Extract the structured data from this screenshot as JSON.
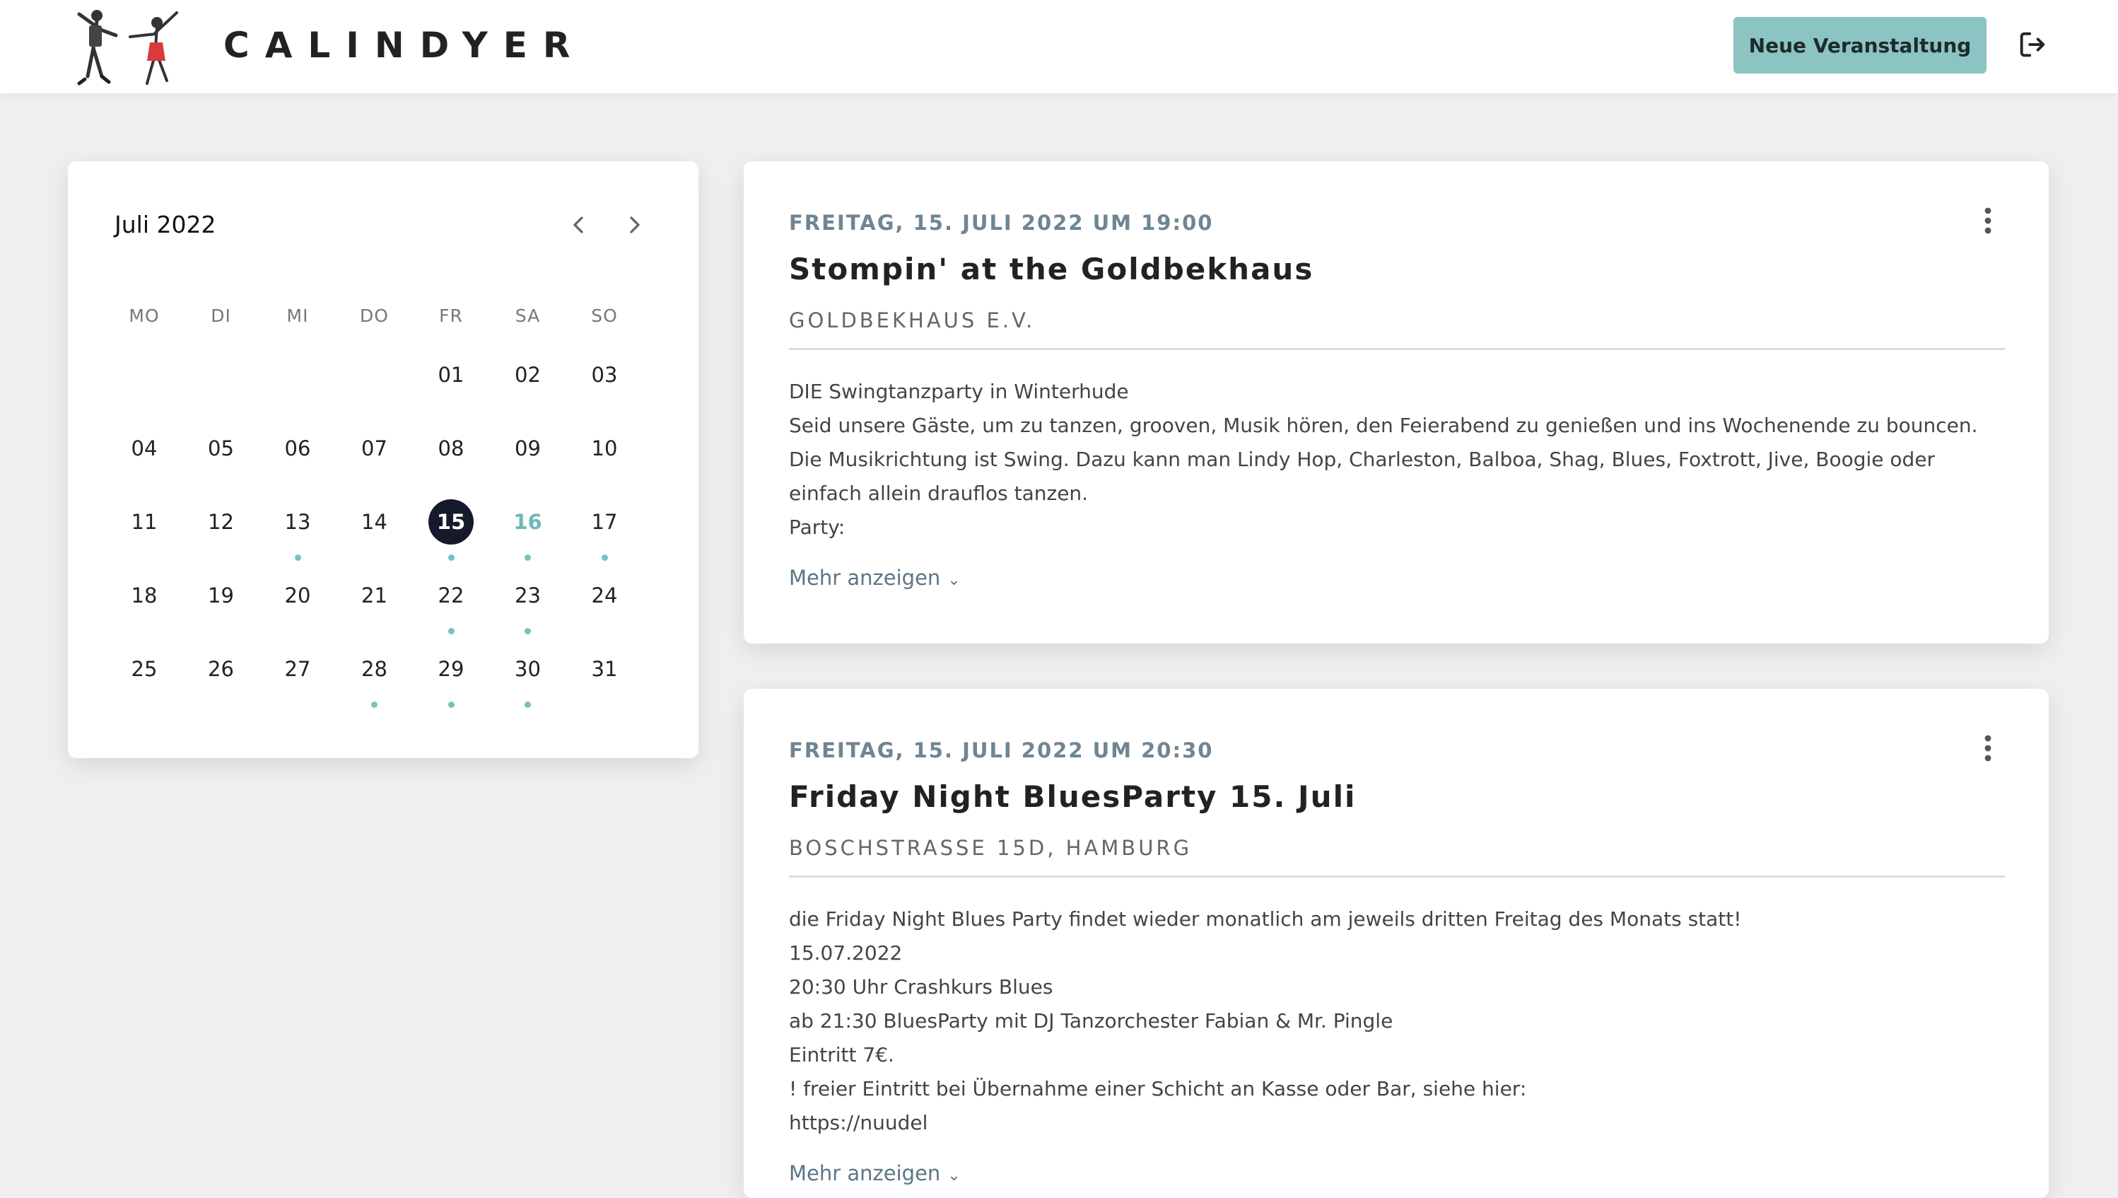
{
  "header": {
    "brand": "CALINDYER",
    "new_event_label": "Neue Veranstaltung"
  },
  "calendar": {
    "month_label": "Juli 2022",
    "weekdays": [
      "MO",
      "DI",
      "MI",
      "DO",
      "FR",
      "SA",
      "SO"
    ],
    "days": [
      [
        "",
        "",
        "",
        "",
        "01",
        "02",
        "03"
      ],
      [
        "04",
        "05",
        "06",
        "07",
        "08",
        "09",
        "10"
      ],
      [
        "11",
        "12",
        "13",
        "14",
        "15",
        "16",
        "17"
      ],
      [
        "18",
        "19",
        "20",
        "21",
        "22",
        "23",
        "24"
      ],
      [
        "25",
        "26",
        "27",
        "28",
        "29",
        "30",
        "31"
      ]
    ],
    "selected_day": "15",
    "highlighted_day": "16",
    "event_days": [
      "13",
      "15",
      "16",
      "17",
      "22",
      "23",
      "28",
      "29",
      "30"
    ]
  },
  "events": [
    {
      "date": "FREITAG, 15. JULI 2022 UM 19:00",
      "title": "Stompin' at the Goldbekhaus",
      "location": "GOLDBEKHAUS E.V.",
      "description": [
        "DIE Swingtanzparty in Winterhude",
        "Seid unsere Gäste, um zu tanzen, grooven, Musik hören, den Feierabend zu genießen und ins Wochenende zu bouncen.",
        "Die Musikrichtung ist Swing. Dazu kann man Lindy Hop, Charleston, Balboa, Shag, Blues, Foxtrott, Jive, Boogie oder",
        "einfach allein drauflos tanzen.",
        "Party:"
      ],
      "more_label": "Mehr anzeigen"
    },
    {
      "date": "FREITAG, 15. JULI 2022 UM 20:30",
      "title": "Friday Night BluesParty 15. Juli",
      "location": "BOSCHSTRASSE 15D, HAMBURG",
      "description": [
        "die Friday Night Blues Party findet wieder monatlich am jeweils dritten Freitag des Monats statt!",
        "15.07.2022",
        "20:30 Uhr Crashkurs Blues",
        "ab 21:30 BluesParty mit DJ Tanzorchester Fabian & Mr. Pingle",
        "Eintritt 7€.",
        "! freier Eintritt bei Übernahme einer Schicht an Kasse oder Bar, siehe hier:",
        "https://nuudel"
      ],
      "more_label": "Mehr anzeigen"
    }
  ],
  "colors": {
    "accent": "#8cc3c3",
    "selected_day": "#141a2a",
    "event_dot": "#7bc0c0",
    "date_text": "#6f8592"
  }
}
